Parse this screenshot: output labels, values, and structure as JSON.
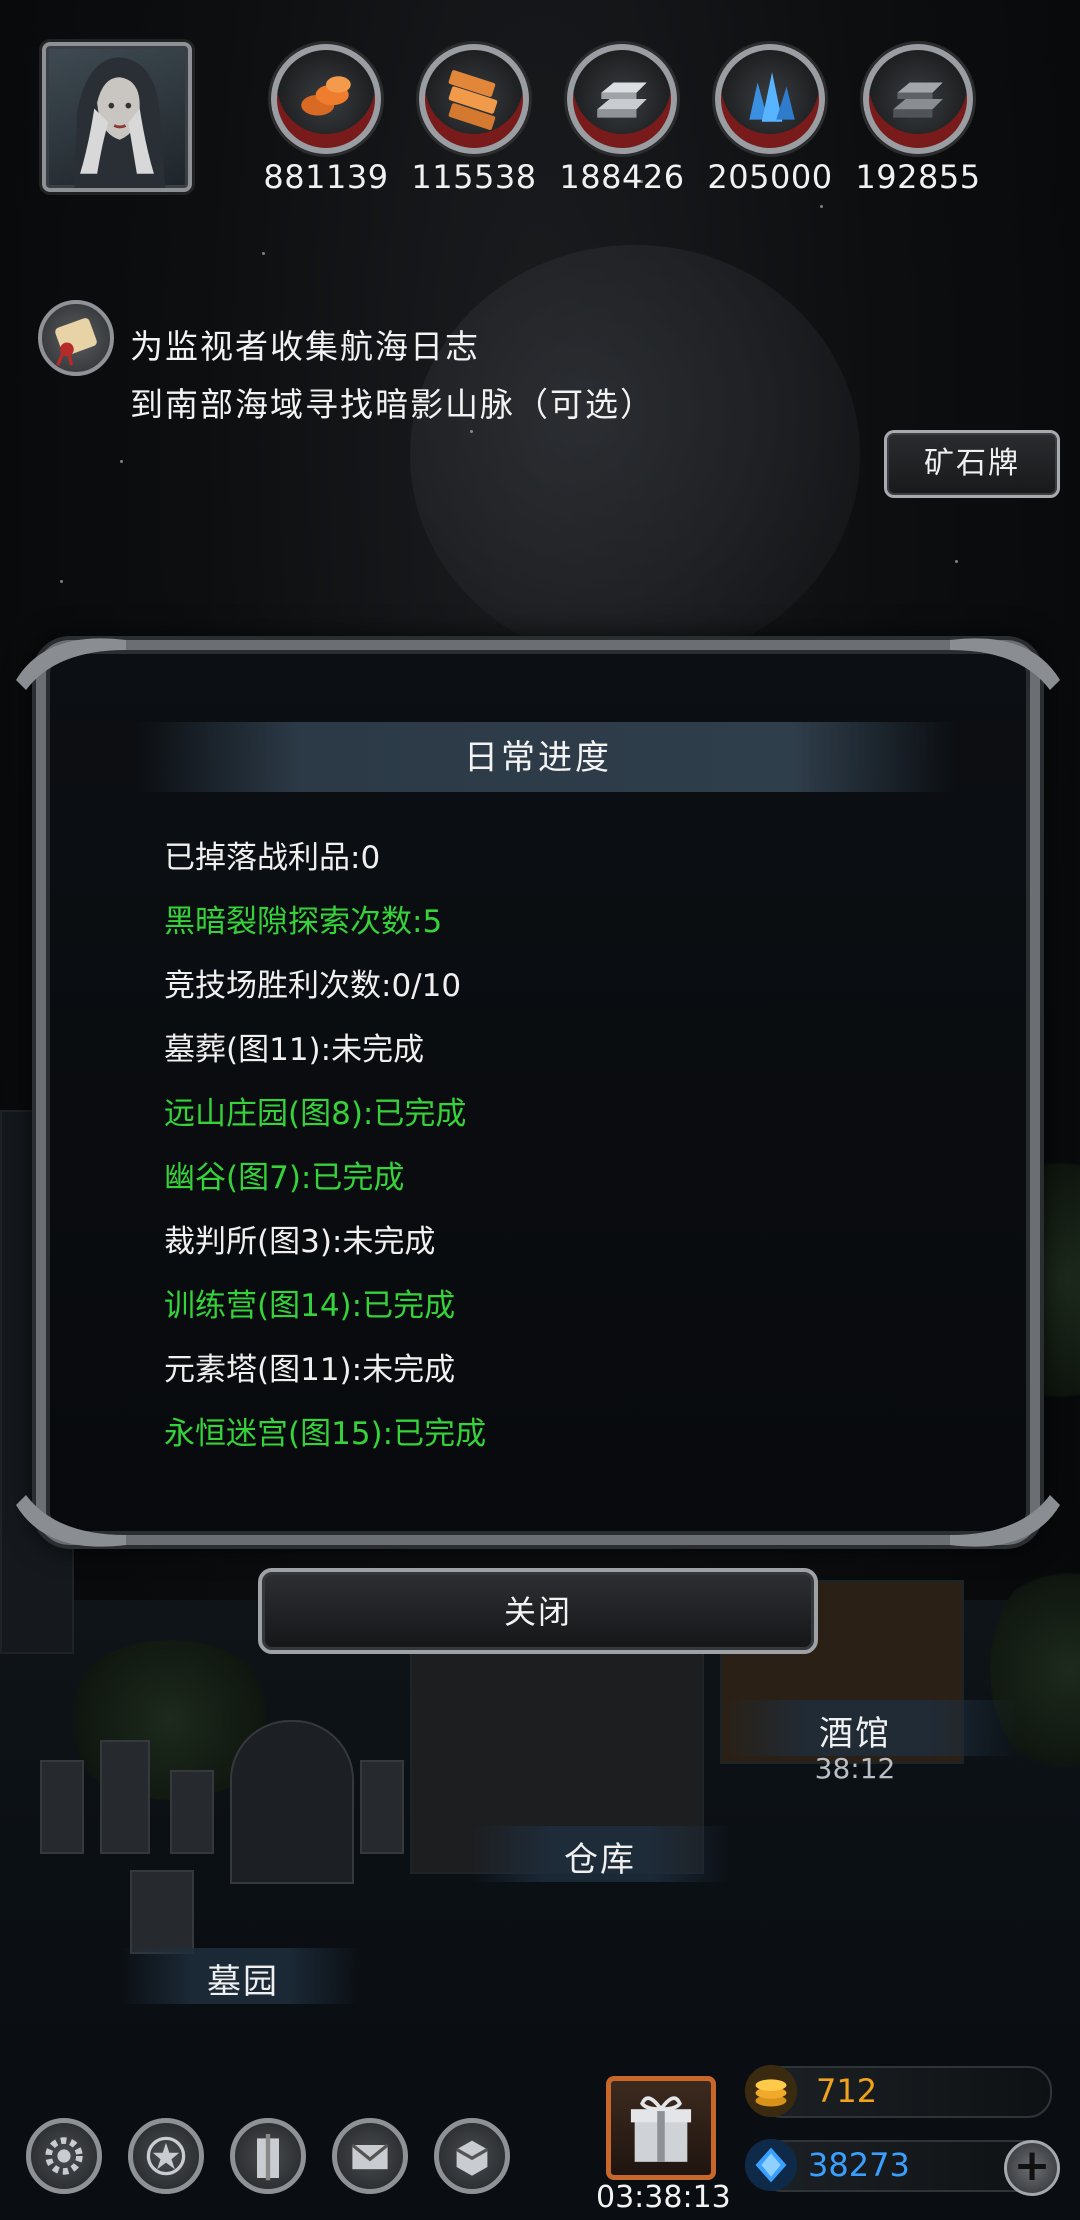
{
  "resources": [
    {
      "icon": "copper-ore-icon",
      "value": "881139"
    },
    {
      "icon": "wood-planks-icon",
      "value": "115538"
    },
    {
      "icon": "iron-ingot-icon",
      "value": "188426"
    },
    {
      "icon": "blue-crystal-icon",
      "value": "205000"
    },
    {
      "icon": "dark-steel-icon",
      "value": "192855"
    }
  ],
  "quest": {
    "line1": "为监视者收集航海日志",
    "line2": "到南部海域寻找暗影山脉（可选）"
  },
  "ore_button": "矿石牌",
  "dialog": {
    "title": "日常进度",
    "stats": [
      {
        "text": "已掉落战利品:0",
        "done": false
      },
      {
        "text": "黑暗裂隙探索次数:5",
        "done": true
      },
      {
        "text": "竞技场胜利次数:0/10",
        "done": false
      },
      {
        "text": "墓葬(图11):未完成",
        "done": false
      },
      {
        "text": "远山庄园(图8):已完成",
        "done": true
      },
      {
        "text": "幽谷(图7):已完成",
        "done": true
      },
      {
        "text": "裁判所(图3):未完成",
        "done": false
      },
      {
        "text": "训练营(图14):已完成",
        "done": true
      },
      {
        "text": "元素塔(图11):未完成",
        "done": false
      },
      {
        "text": "永恒迷宫(图15):已完成",
        "done": true
      }
    ],
    "close": "关闭"
  },
  "locations": {
    "tavern": "酒馆",
    "tavern_timer": "38:12",
    "warehouse": "仓库",
    "cemetery": "墓园"
  },
  "bottom": {
    "gift_timer": "03:38:13",
    "gold": "712",
    "gems": "38273",
    "nav_icons": [
      "settings-gear-icon",
      "achievement-star-icon",
      "guild-banner-icon",
      "mail-icon",
      "shop-icon"
    ]
  },
  "colors": {
    "done": "#35d23a",
    "pending": "#f0f0f0",
    "gold_text": "#f0a21a",
    "gem_text": "#3aa0ff"
  }
}
